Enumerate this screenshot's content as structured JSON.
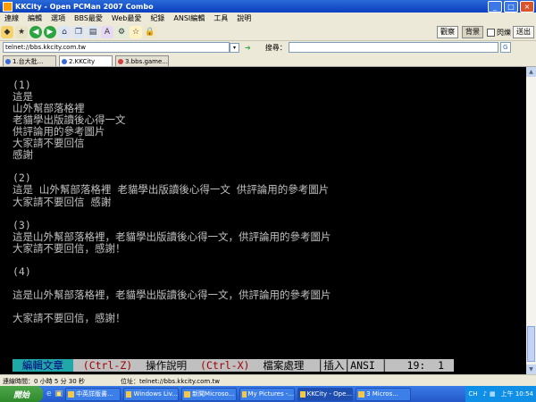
{
  "window": {
    "title": "KKCity - Open PCMan 2007 Combo",
    "min": "_",
    "max": "□",
    "close": "×"
  },
  "menu": [
    "連線",
    "編輯",
    "選項",
    "BBS最愛",
    "Web最愛",
    "紀錄",
    "ANSI編輯",
    "工具",
    "說明"
  ],
  "toolbar": {
    "btn1": "觀察",
    "btn2": "背景",
    "checkbox_label": "閃爍",
    "btn3": "送出",
    "icons": [
      "new-connection-icon",
      "favorites-icon",
      "back-icon",
      "forward-icon",
      "home-icon",
      "copy-icon",
      "paste-icon",
      "ansi-icon",
      "settings-icon",
      "star-icon",
      "lock-icon"
    ]
  },
  "address": {
    "url": "telnet://bbs.kkcity.com.tw",
    "search_label": "搜尋：",
    "search_placeholder": ""
  },
  "tabs": [
    "1.台大批...",
    "2.KKCity",
    "3.bbs.game..."
  ],
  "terminal": {
    "lines": [
      {
        "row": 0,
        "text": "(1)"
      },
      {
        "row": 1,
        "text": "這是"
      },
      {
        "row": 2,
        "text": "山外幫部落格裡"
      },
      {
        "row": 3,
        "text": "老貓學出版讀後心得一文"
      },
      {
        "row": 4,
        "text": "供評論用的參考圖片"
      },
      {
        "row": 5,
        "text": "大家請不要回信"
      },
      {
        "row": 6,
        "text": "感謝"
      },
      {
        "row": 8,
        "text": "(2)"
      },
      {
        "row": 9,
        "text": "這是 山外幫部落格裡 老貓學出版讀後心得一文 供評論用的參考圖片"
      },
      {
        "row": 10,
        "text": "大家請不要回信 感謝"
      },
      {
        "row": 12,
        "text": "(3)"
      },
      {
        "row": 13,
        "text": "這是山外幫部落格裡，老貓學出版讀後心得一文，供評論用的參考圖片"
      },
      {
        "row": 14,
        "text": "大家請不要回信，感謝！"
      },
      {
        "row": 16,
        "text": "(4)"
      },
      {
        "row": 18,
        "text": "這是山外幫部落格裡，老貓學出版讀後心得一文，供評論用的參考圖片"
      },
      {
        "row": 20,
        "text": "大家請不要回信，感謝！"
      }
    ],
    "status": [
      {
        "text": " 編輯文章 ",
        "fg": "#000080",
        "bg": "#20a8a8"
      },
      {
        "text": " (Ctrl-Z) ",
        "fg": "#a00000",
        "bg": "#c0c0c0"
      },
      {
        "text": "操作說明 ",
        "fg": "#000000",
        "bg": "#c0c0c0"
      },
      {
        "text": "(Ctrl-X) ",
        "fg": "#a00000",
        "bg": "#c0c0c0"
      },
      {
        "text": "檔案處理 ",
        "fg": "#000000",
        "bg": "#c0c0c0"
      },
      {
        "text": "│插入│ANSI │",
        "fg": "#000000",
        "bg": "#c0c0c0"
      },
      {
        "text": "  19:  1 ",
        "fg": "#000000",
        "bg": "#c0c0c0"
      }
    ]
  },
  "statusbar": {
    "connected": "連線時間：0 小時 5 分 30 秒",
    "location": "位址：telnet://bbs.kkcity.com.tw"
  },
  "taskbar": {
    "start": "開始",
    "tasks": [
      "中英詳版書...",
      "Windows Liv...",
      "新聞Microso...",
      "My Pictures -...",
      "KKCity - Ope...",
      "3 Micros..."
    ],
    "active_task": 4,
    "lang": "CH",
    "clock": "上午 10:54"
  },
  "colors": {
    "terminal_bg": "#000000",
    "terminal_fg": "#c0c0c0",
    "titlebar": "#0a3fbf"
  }
}
